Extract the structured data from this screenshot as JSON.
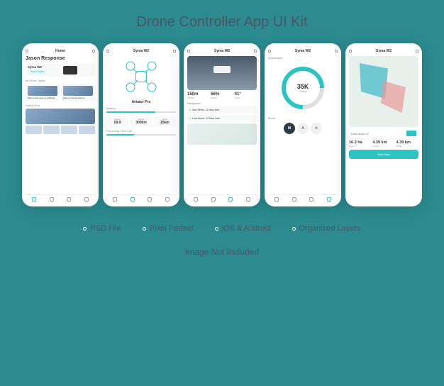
{
  "title": "Drone Controller App UI Kit",
  "features": [
    "PSD File",
    "Pixel Perfect",
    "iOS & Android",
    "Organized Layers"
  ],
  "footer": "Image Not Included",
  "screen1": {
    "header": "Home",
    "username": "Jason Response",
    "drone_name": "Syma W2",
    "engine_btn": "Start Engine",
    "shots_label": "All Shots Today",
    "shot1": "Take a nice view on a Beach",
    "shot2": "Take a cinema video to",
    "latest_label": "Latest Shot"
  },
  "screen2": {
    "header": "Syma W2",
    "drone_title": "Aviator Pro",
    "battery_label": "Battery",
    "battery_pct": 70,
    "speed_label": "Speed",
    "speed_val": "59.9",
    "range_label": "Range",
    "range_val": "3000m",
    "wind_label": "Wind",
    "wind_val": "15km",
    "rec_label": "Recording Time Left",
    "rec_pct": 40
  },
  "screen3": {
    "header": "Syma W2",
    "alt": "150m",
    "alt_label": "Altitude",
    "pct": "56%",
    "pct_label": "Battery",
    "deg": "41°",
    "deg_label": "Angle",
    "nav_label": "Navigation",
    "loc1": "Sun Street, 11 New York",
    "loc2": "Leaf Street, 12 New York"
  },
  "screen4": {
    "header": "Syma W2",
    "sub": "Quadcopter",
    "val": "35K",
    "val_label": "Rating",
    "mode_label": "Mode",
    "modes": [
      "M",
      "A"
    ]
  },
  "screen5": {
    "header": "Syma W2",
    "land_label": "Land Area #7",
    "area": "16.3 ha",
    "area_label": "Area",
    "dist1": "4.39 km",
    "dist1_label": "Length",
    "dist2": "4.39 km",
    "dist2_label": "Width",
    "cta": "Start Now"
  }
}
